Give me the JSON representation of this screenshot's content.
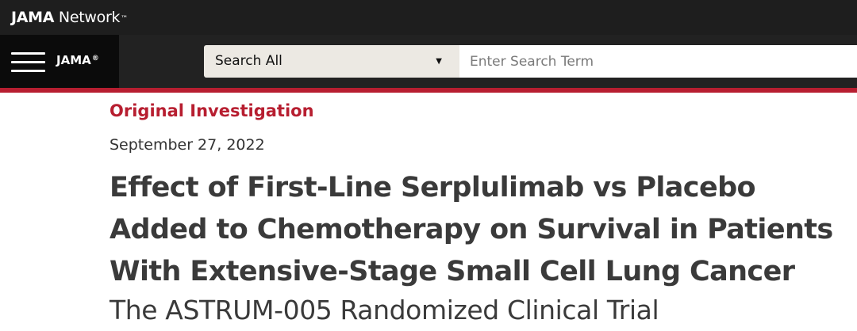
{
  "header": {
    "brand_bold": "JAMA",
    "brand_light": " Network",
    "brand_tm": "™",
    "journal": "JAMA",
    "journal_mark": "®",
    "menu_icon": "hamburger-menu-icon"
  },
  "search": {
    "scope_label": "Search All",
    "scope_caret": "▼",
    "placeholder": "Enter Search Term",
    "value": ""
  },
  "colors": {
    "accent": "#b71e30",
    "topbar": "#1e1e1e",
    "navbar": "#222222",
    "menu_block": "#0b0b0b",
    "select_bg": "#ece9e3"
  },
  "article": {
    "type": "Original Investigation",
    "date": "September 27, 2022",
    "title_lines": [
      "Effect of First-Line Serplulimab vs Placebo",
      "Added to Chemotherapy on Survival in Patients",
      "With Extensive-Stage Small Cell Lung Cancer"
    ],
    "subtitle": "The ASTRUM-005 Randomized Clinical Trial"
  }
}
